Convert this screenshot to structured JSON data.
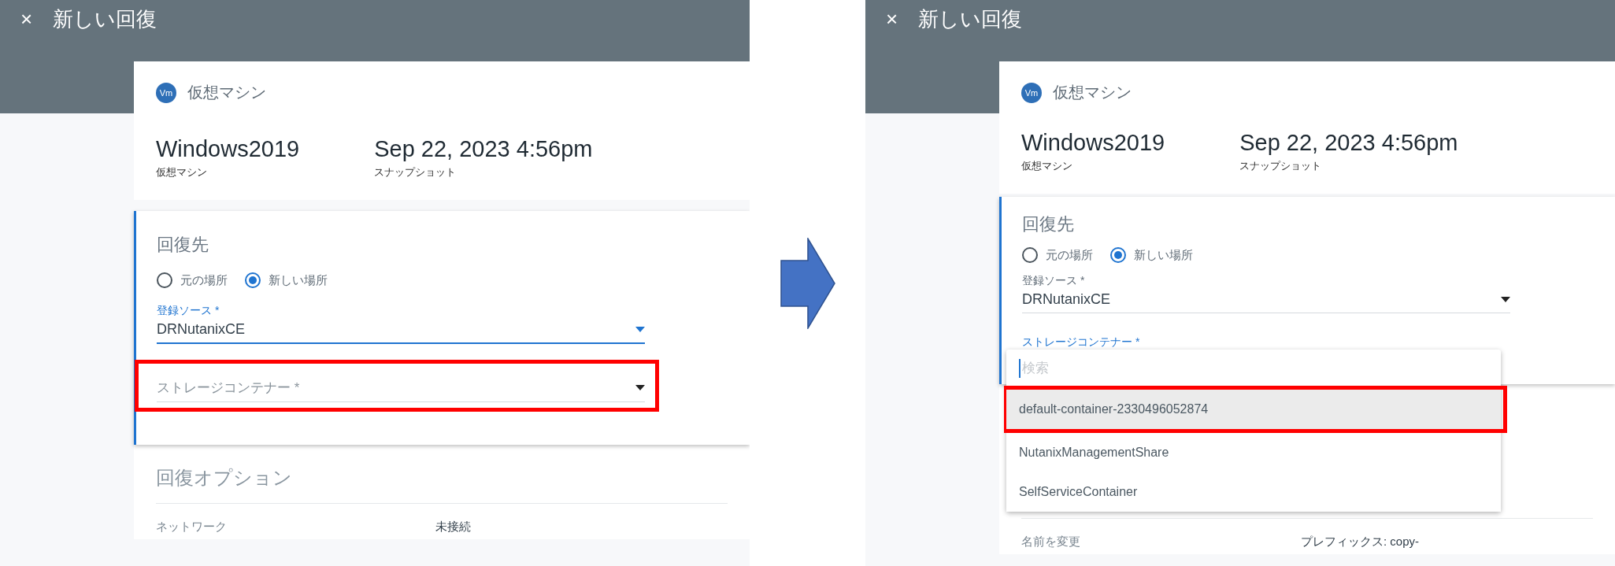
{
  "panels": [
    {
      "header": {
        "close": "×",
        "title": "新しい回復"
      },
      "vm_card": {
        "badge": "Vm",
        "type_label": "仮想マシン",
        "name": "Windows2019",
        "name_caption": "仮想マシン",
        "snapshot": "Sep 22, 2023 4:56pm",
        "snapshot_caption": "スナップショット"
      },
      "destination": {
        "title": "回復先",
        "options": [
          {
            "label": "元の場所",
            "selected": false
          },
          {
            "label": "新しい場所",
            "selected": true
          }
        ],
        "source_field": {
          "label": "登録ソース *",
          "value": "DRNutanixCE",
          "focused": true
        },
        "storage_field": {
          "placeholder": "ストレージコンテナー *",
          "focused": false,
          "annotated": true
        }
      },
      "options_section": {
        "title": "回復オプション",
        "rows": [
          {
            "label": "ネットワーク",
            "value": "未接続"
          }
        ]
      }
    },
    {
      "header": {
        "close": "×",
        "title": "新しい回復"
      },
      "vm_card": {
        "badge": "Vm",
        "type_label": "仮想マシン",
        "name": "Windows2019",
        "name_caption": "仮想マシン",
        "snapshot": "Sep 22, 2023 4:56pm",
        "snapshot_caption": "スナップショット"
      },
      "destination": {
        "title": "回復先",
        "options": [
          {
            "label": "元の場所",
            "selected": false
          },
          {
            "label": "新しい場所",
            "selected": true
          }
        ],
        "source_field": {
          "label": "登録ソース *",
          "value": "DRNutanixCE",
          "focused": false
        },
        "storage_field": {
          "label": "ストレージコンテナー *",
          "focused": true,
          "dropdown": {
            "search_placeholder": "検索",
            "items": [
              {
                "label": "default-container-2330496052874",
                "highlighted": true,
                "annotated": true
              },
              {
                "label": "NutanixManagementShare",
                "highlighted": false,
                "annotated": false
              },
              {
                "label": "SelfServiceContainer",
                "highlighted": false,
                "annotated": false
              }
            ]
          }
        }
      },
      "options_section": {
        "rows": [
          {
            "label": "名前を変更",
            "value": "プレフィックス: copy-"
          }
        ]
      }
    }
  ]
}
